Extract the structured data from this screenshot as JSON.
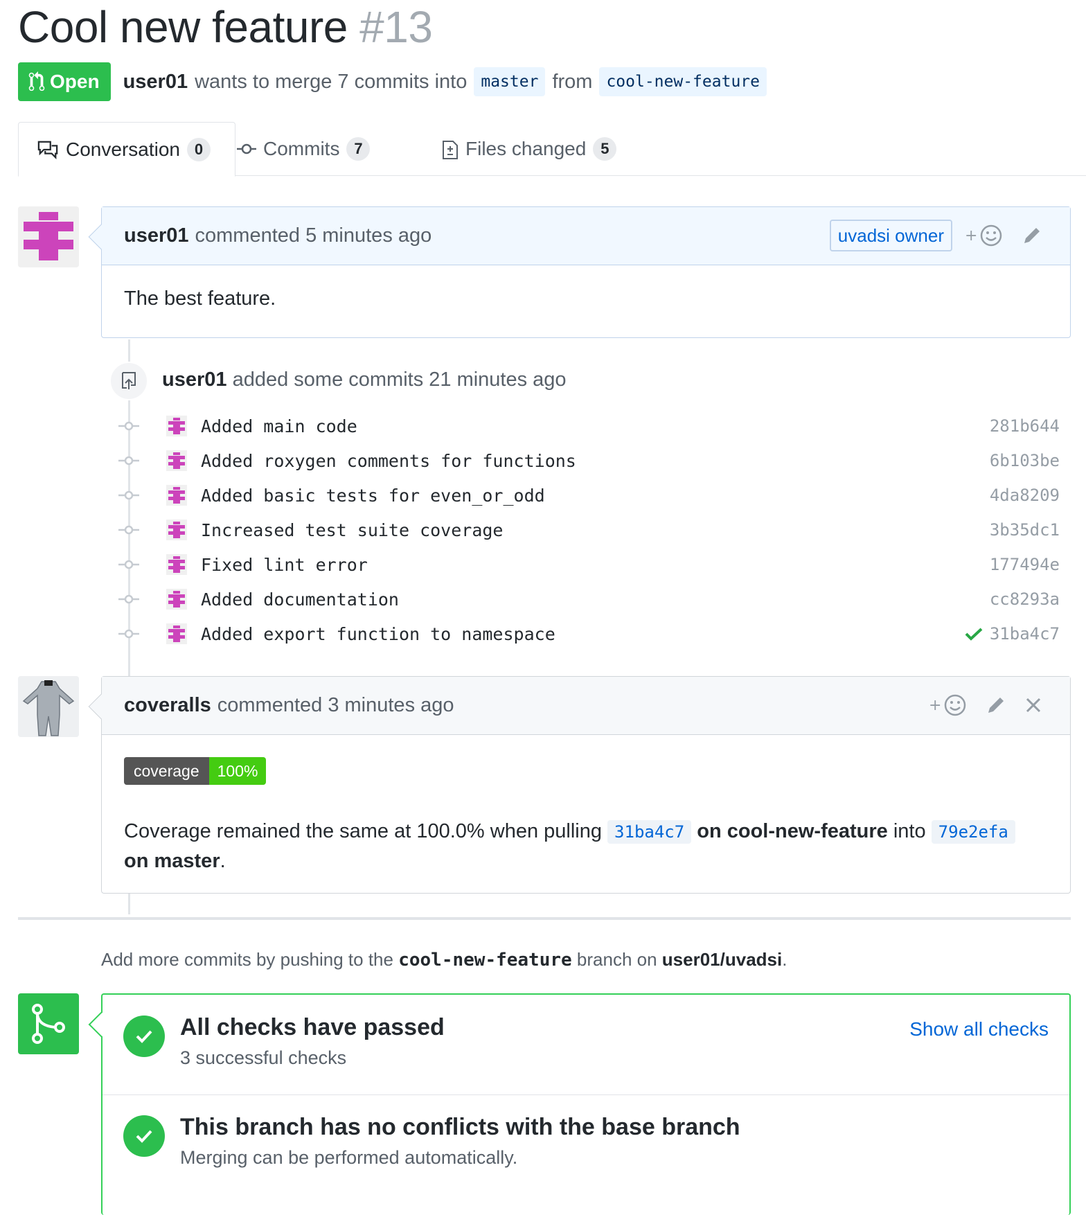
{
  "header": {
    "title": "Cool new feature",
    "number": "#13",
    "state": "Open",
    "author": "user01",
    "merge_text": "wants to merge 7 commits into",
    "base_branch": "master",
    "from_text": "from",
    "head_branch": "cool-new-feature"
  },
  "tabs": [
    {
      "label": "Conversation",
      "count": "0"
    },
    {
      "label": "Commits",
      "count": "7"
    },
    {
      "label": "Files changed",
      "count": "5"
    }
  ],
  "first_comment": {
    "author": "user01",
    "action": "commented 5 minutes ago",
    "label": "uvadsi owner",
    "body": "The best feature."
  },
  "commits_event": {
    "author": "user01",
    "action": "added some commits 21 minutes ago",
    "commits": [
      {
        "message": "Added main code",
        "sha": "281b644"
      },
      {
        "message": "Added roxygen comments for functions",
        "sha": "6b103be"
      },
      {
        "message": "Added basic tests for even_or_odd",
        "sha": "4da8209"
      },
      {
        "message": "Increased test suite coverage",
        "sha": "3b35dc1"
      },
      {
        "message": "Fixed lint error",
        "sha": "177494e"
      },
      {
        "message": "Added documentation",
        "sha": "cc8293a"
      },
      {
        "message": "Added export function to namespace",
        "sha": "31ba4c7"
      }
    ]
  },
  "second_comment": {
    "author": "coveralls",
    "action": "commented 3 minutes ago",
    "badge_left": "coverage",
    "badge_right": "100%",
    "text_1": "Coverage remained the same at 100.0% when pulling",
    "sha_1": "31ba4c7",
    "text_2": "on cool-new-feature",
    "text_3": "into",
    "sha_2": "79e2efa",
    "text_4": "on master",
    "text_5": "."
  },
  "push_hint": {
    "prefix": "Add more commits by pushing to the",
    "branch": "cool-new-feature",
    "middle": "branch on",
    "repo": "user01/uvadsi",
    "suffix": "."
  },
  "merge_box": {
    "checks_title": "All checks have passed",
    "checks_sub": "3 successful checks",
    "show_all": "Show all checks",
    "conflict_title": "This branch has no conflicts with the base branch",
    "conflict_sub": "Merging can be performed automatically."
  },
  "colors": {
    "green": "#2cbe4e",
    "link_blue": "#0366d6",
    "avatar_magenta": "#cc44bb"
  }
}
